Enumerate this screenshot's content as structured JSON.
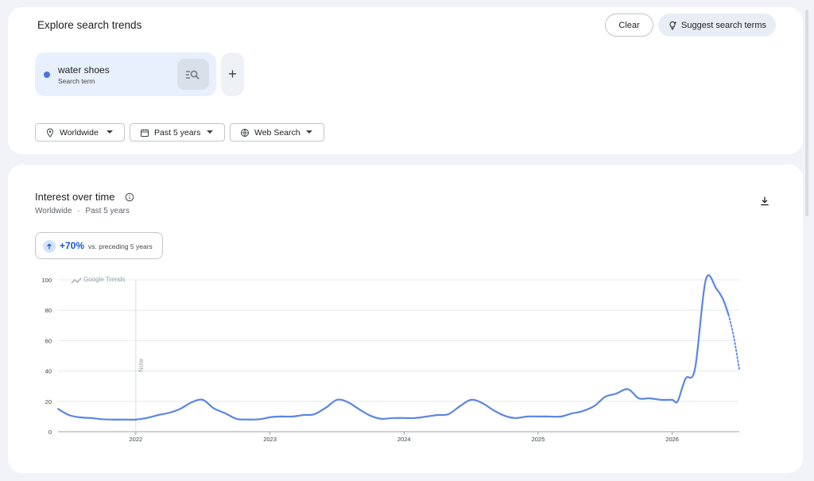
{
  "header": {
    "title": "Explore search trends",
    "clear_label": "Clear",
    "suggest_label": "Suggest search terms"
  },
  "term": {
    "name": "water shoes",
    "type": "Search term",
    "color": "#4a72dd",
    "icon": "search-list-icon"
  },
  "add_term": {
    "label": "+"
  },
  "filters": {
    "location": "Worldwide",
    "time": "Past 5 years",
    "property": "Web Search"
  },
  "interest": {
    "title": "Interest over time",
    "location": "Worldwide",
    "dot": "·",
    "range": "Past 5 years",
    "change_value": "+70%",
    "change_label": "vs. preceding 5 years",
    "watermark": "Google Trends",
    "note_label": "Note"
  },
  "chart_data": {
    "type": "line",
    "series_color": "#5b86e5",
    "yticks": [
      0,
      20,
      40,
      60,
      80,
      100
    ],
    "ylim": [
      0,
      100
    ],
    "xlim": [
      2021.42,
      2026.5
    ],
    "xticks": [
      "2022",
      "2023",
      "2024",
      "2025",
      "2026"
    ],
    "grid": true,
    "note_x": 2022.0,
    "series": [
      {
        "points": [
          [
            2021.42,
            15
          ],
          [
            2021.5,
            11
          ],
          [
            2021.58,
            9.5
          ],
          [
            2021.67,
            9
          ],
          [
            2021.75,
            8.2
          ],
          [
            2021.83,
            8
          ],
          [
            2021.92,
            8
          ],
          [
            2022.0,
            8
          ],
          [
            2022.08,
            9
          ],
          [
            2022.17,
            11
          ],
          [
            2022.25,
            12.5
          ],
          [
            2022.33,
            15
          ],
          [
            2022.42,
            19.5
          ],
          [
            2022.5,
            21
          ],
          [
            2022.58,
            15.5
          ],
          [
            2022.67,
            12
          ],
          [
            2022.75,
            8.5
          ],
          [
            2022.83,
            8
          ],
          [
            2022.92,
            8.2
          ],
          [
            2023.0,
            9.5
          ],
          [
            2023.08,
            10
          ],
          [
            2023.17,
            10
          ],
          [
            2023.25,
            11
          ],
          [
            2023.33,
            11.5
          ],
          [
            2023.42,
            16
          ],
          [
            2023.5,
            21
          ],
          [
            2023.58,
            19.5
          ],
          [
            2023.67,
            14.5
          ],
          [
            2023.75,
            10.5
          ],
          [
            2023.83,
            8.5
          ],
          [
            2023.92,
            9
          ],
          [
            2024.0,
            9
          ],
          [
            2024.08,
            9
          ],
          [
            2024.17,
            10
          ],
          [
            2024.25,
            11
          ],
          [
            2024.33,
            11.5
          ],
          [
            2024.42,
            17
          ],
          [
            2024.5,
            21
          ],
          [
            2024.58,
            19
          ],
          [
            2024.67,
            14
          ],
          [
            2024.75,
            10.5
          ],
          [
            2024.83,
            9
          ],
          [
            2024.92,
            10
          ],
          [
            2025.0,
            10
          ],
          [
            2025.08,
            10
          ],
          [
            2025.17,
            10
          ],
          [
            2025.25,
            12
          ],
          [
            2025.33,
            13.5
          ],
          [
            2025.42,
            17
          ],
          [
            2025.5,
            23
          ],
          [
            2025.58,
            25
          ],
          [
            2025.67,
            28
          ],
          [
            2025.75,
            22
          ],
          [
            2025.83,
            22
          ],
          [
            2025.92,
            21
          ],
          [
            2026.0,
            21
          ],
          [
            2026.04,
            20
          ],
          [
            2026.1,
            35
          ],
          [
            2026.17,
            41.5
          ],
          [
            2026.25,
            100
          ],
          [
            2026.33,
            94
          ],
          [
            2026.38,
            87
          ],
          [
            2026.42,
            77
          ]
        ]
      },
      {
        "partial": true,
        "points": [
          [
            2026.42,
            77
          ],
          [
            2026.46,
            62
          ],
          [
            2026.5,
            41
          ]
        ]
      }
    ]
  }
}
